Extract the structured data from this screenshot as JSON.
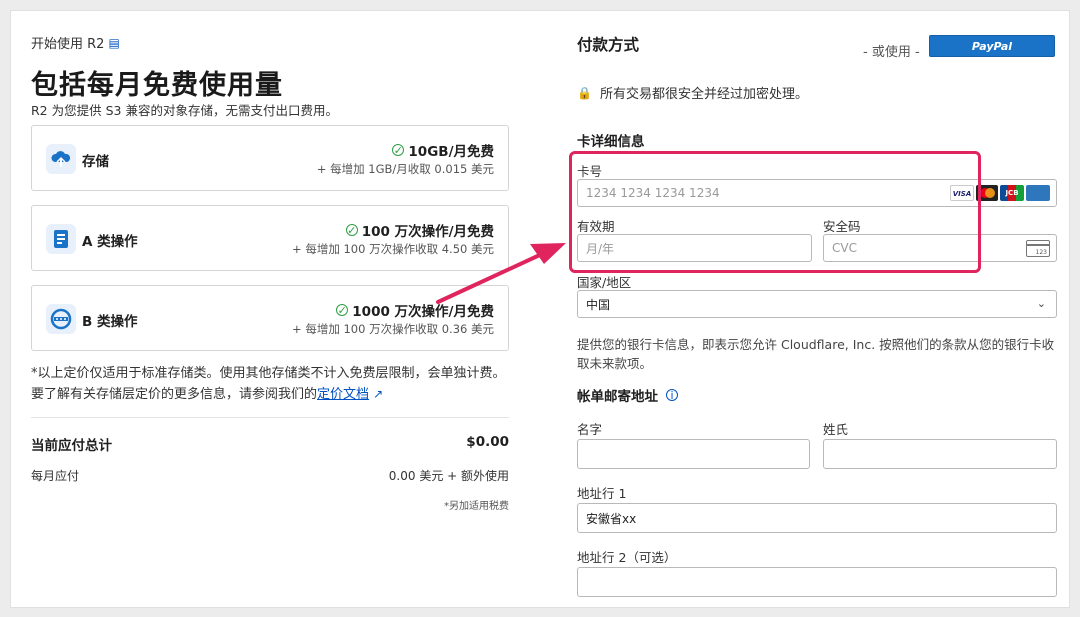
{
  "left": {
    "breadcrumb": "开始使用 R2",
    "title": "包括每月免费使用量",
    "subtitle": "R2 为您提供 S3 兼容的对象存储，无需支付出口费用。",
    "tiles": [
      {
        "name": "存储",
        "free": "10GB/月免费",
        "extra": "+ 每增加 1GB/月收取 0.015 美元",
        "icon": "cloud-storage-icon"
      },
      {
        "name": "A 类操作",
        "free": "100 万次操作/月免费",
        "extra": "+ 每增加 100 万次操作收取 4.50 美元",
        "icon": "class-a-operations-icon"
      },
      {
        "name": "B 类操作",
        "free": "1000 万次操作/月免费",
        "extra": "+ 每增加 100 万次操作收取 0.36 美元",
        "icon": "class-b-operations-icon"
      }
    ],
    "note_text": "*以上定价仅适用于标准存储类。使用其他存储类不计入免费层限制，会单独计费。要了解有关存储层定价的更多信息，请参阅我们的",
    "note_link": "定价文档",
    "total_label": "当前应付总计",
    "total_value": "$0.00",
    "monthly_label": "每月应付",
    "monthly_value": "0.00 美元 + 额外使用",
    "tax_note": "*另加适用税费"
  },
  "right": {
    "payment_title": "付款方式",
    "or_use": "- 或使用 -",
    "paypal_label": "PayPal",
    "secure_text": "所有交易都很安全并经过加密处理。",
    "card_section_title": "卡详细信息",
    "card_number_label": "卡号",
    "card_number_placeholder": "1234 1234 1234 1234",
    "card_brands": [
      "VISA",
      "Mastercard",
      "JCB",
      "AMEX"
    ],
    "expiry_label": "有效期",
    "expiry_placeholder": "月/年",
    "cvc_label": "安全码",
    "cvc_placeholder": "CVC",
    "cvc_icon_text": "123",
    "country_label": "国家/地区",
    "country_value": "中国",
    "help_text": "提供您的银行卡信息，即表示您允许 Cloudflare, Inc. 按照他们的条款从您的银行卡收取未来款项。",
    "billing_title": "帐单邮寄地址",
    "first_name_label": "名字",
    "first_name_value": "",
    "last_name_label": "姓氏",
    "last_name_value": "",
    "address1_label": "地址行 1",
    "address1_value": "安徽省xx",
    "address2_label": "地址行 2（可选）",
    "address2_value": ""
  },
  "colors": {
    "accent_blue": "#0051c3",
    "highlight": "#e0245e",
    "success_green": "#2f9e44"
  }
}
